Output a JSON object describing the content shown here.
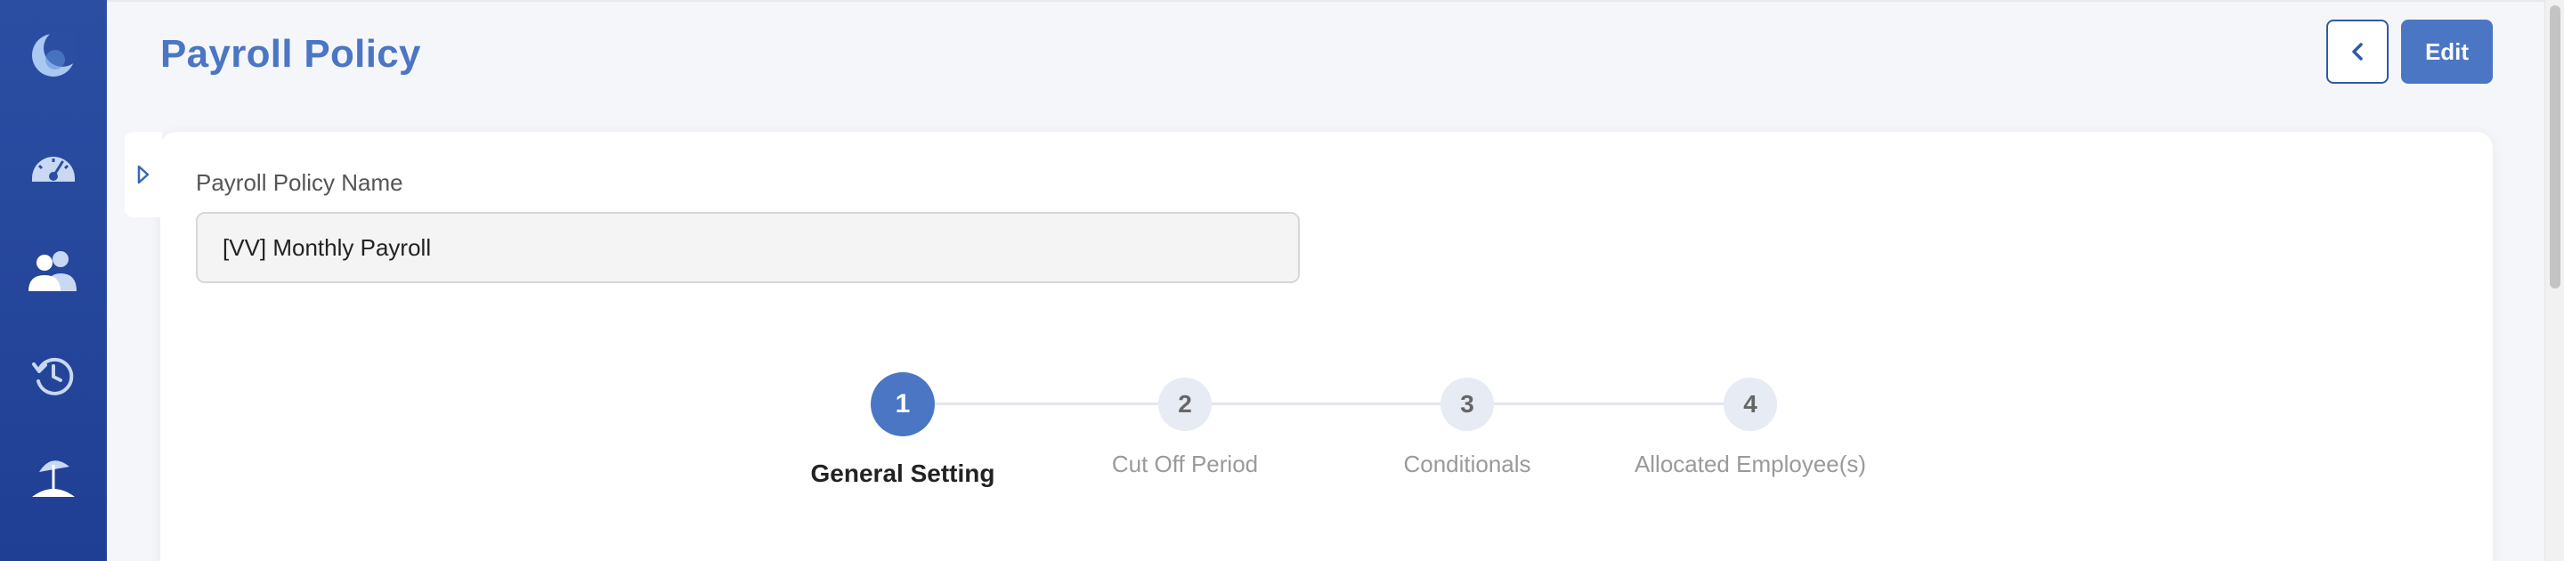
{
  "page": {
    "title": "Payroll Policy"
  },
  "header": {
    "edit_label": "Edit"
  },
  "sidebar": {
    "items": [
      {
        "icon": "moon-logo-icon"
      },
      {
        "icon": "dashboard-gauge-icon"
      },
      {
        "icon": "people-icon"
      },
      {
        "icon": "history-clock-icon"
      },
      {
        "icon": "beach-umbrella-icon"
      }
    ]
  },
  "form": {
    "name_label": "Payroll Policy Name",
    "name_value": "[VV] Monthly Payroll"
  },
  "stepper": {
    "steps": [
      {
        "number": "1",
        "label": "General Setting",
        "active": true
      },
      {
        "number": "2",
        "label": "Cut Off Period",
        "active": false
      },
      {
        "number": "3",
        "label": "Conditionals",
        "active": false
      },
      {
        "number": "4",
        "label": "Allocated Employee(s)",
        "active": false
      }
    ]
  },
  "colors": {
    "sidebar": "#2b4ea3",
    "accent": "#4a76c4",
    "title": "#4a76c4",
    "inactive_step": "#e7ebf3"
  }
}
